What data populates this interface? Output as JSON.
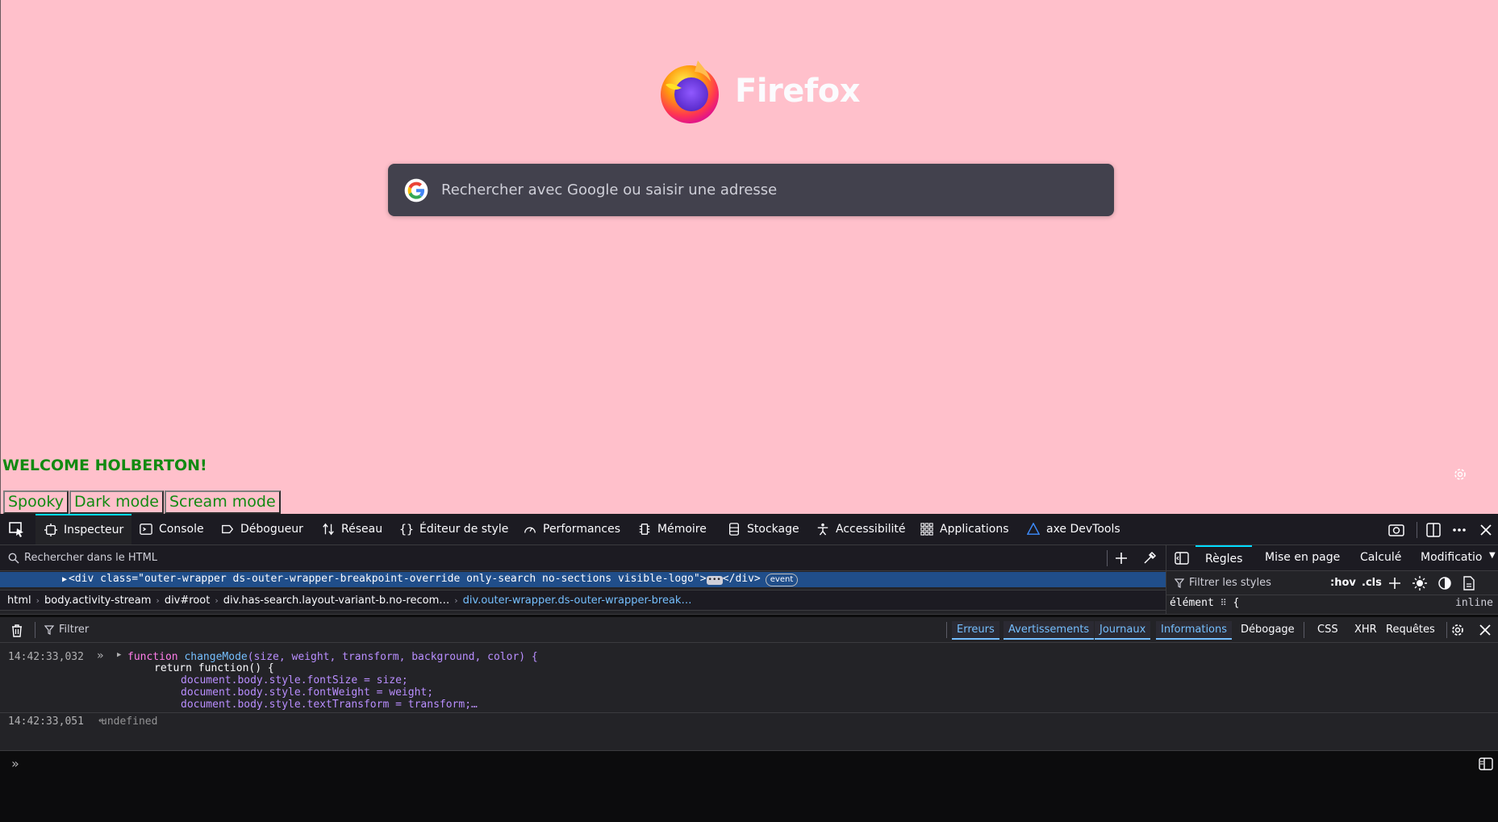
{
  "page": {
    "brand_name": "Firefox",
    "search_placeholder": "Rechercher avec Google ou saisir une adresse",
    "welcome_text": "WELCOME HOLBERTON!",
    "mode_buttons": [
      "Spooky",
      "Dark mode",
      "Scream mode"
    ],
    "background_color": "#ffc0cb",
    "welcome_color": "#128a12"
  },
  "devtools": {
    "tools": [
      {
        "label": "Inspecteur",
        "icon": "inspector-icon",
        "active": true
      },
      {
        "label": "Console",
        "icon": "console-icon"
      },
      {
        "label": "Débogueur",
        "icon": "debugger-icon"
      },
      {
        "label": "Réseau",
        "icon": "network-icon"
      },
      {
        "label": "Éditeur de style",
        "icon": "style-editor-icon"
      },
      {
        "label": "Performances",
        "icon": "performance-icon"
      },
      {
        "label": "Mémoire",
        "icon": "memory-icon"
      },
      {
        "label": "Stockage",
        "icon": "storage-icon"
      },
      {
        "label": "Accessibilité",
        "icon": "accessibility-icon"
      },
      {
        "label": "Applications",
        "icon": "applications-icon"
      },
      {
        "label": "axe DevTools",
        "icon": "axe-icon"
      }
    ],
    "html_search_placeholder": "Rechercher dans le HTML",
    "selected_markup": "<div class=\"outer-wrapper ds-outer-wrapper-breakpoint-override only-search no-sections visible-logo\">",
    "selected_markup_close": "</div>",
    "event_badge": "event",
    "breadcrumbs": [
      "html",
      "body.activity-stream",
      "div#root",
      "div.has-search.layout-variant-b.no-recom…",
      "div.outer-wrapper.ds-outer-wrapper-break…"
    ],
    "rules_tabs": [
      "Règles",
      "Mise en page",
      "Calculé",
      "Modificatio"
    ],
    "rules_filter_placeholder": "Filtrer les styles",
    "rules_buttons": [
      ":hov",
      ".cls"
    ],
    "rules_element": "élément",
    "rules_brace": "{",
    "rules_inline": "inline",
    "console_filter_placeholder": "Filtrer",
    "console_filters": [
      {
        "label": "Erreurs",
        "on": true
      },
      {
        "label": "Avertissements",
        "on": true
      },
      {
        "label": "Journaux",
        "on": true
      },
      {
        "label": "Informations",
        "on": true
      },
      {
        "label": "Débogage",
        "on": false
      }
    ],
    "console_type_filters": [
      "CSS",
      "XHR",
      "Requêtes"
    ],
    "console_entries": [
      {
        "timestamp": "14:42:33,032"
      },
      {
        "timestamp": "14:42:33,051",
        "result": "undefined"
      }
    ],
    "code": {
      "line1_kw": "function",
      "line1_name": "changeMode",
      "line1_params": "(size, weight, transform, background, color) {",
      "line2": "return function() {",
      "line3": "document.body.style.fontSize = size;",
      "line4": "document.body.style.fontWeight = weight;",
      "line5": "document.body.style.textTransform = transform;…"
    }
  }
}
